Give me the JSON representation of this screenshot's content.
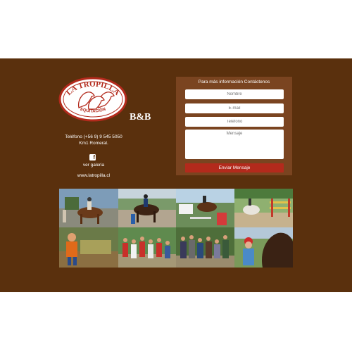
{
  "brand": {
    "logo_top_text": "LA TROPILLA",
    "logo_bottom_text": "EQUITACIÓN",
    "suffix": "B&B"
  },
  "contact": {
    "phone": "Teléfono (+56 9) 9 545 5050",
    "address": "Km1 Romeral.",
    "gallery_link": "ver galeria",
    "website": "www.latropilla.cl"
  },
  "form": {
    "title": "Para más información Contáctenos",
    "name_placeholder": "Nombre",
    "email_placeholder": "E-mail",
    "phone_placeholder": "Teléfono",
    "message_placeholder": "Mensaje",
    "submit_label": "Enviar Mensaje"
  },
  "colors": {
    "panel_bg": "#5a300d",
    "form_bg": "#7a4420",
    "submit_bg": "#b32a1c"
  },
  "gallery": {
    "items": [
      "horse-riding-lesson-photo",
      "horse-rider-photo",
      "show-jumping-photo",
      "jumping-arena-photo",
      "child-hay-photo",
      "kids-group-photo",
      "family-group-photo",
      "child-with-horse-photo"
    ]
  }
}
